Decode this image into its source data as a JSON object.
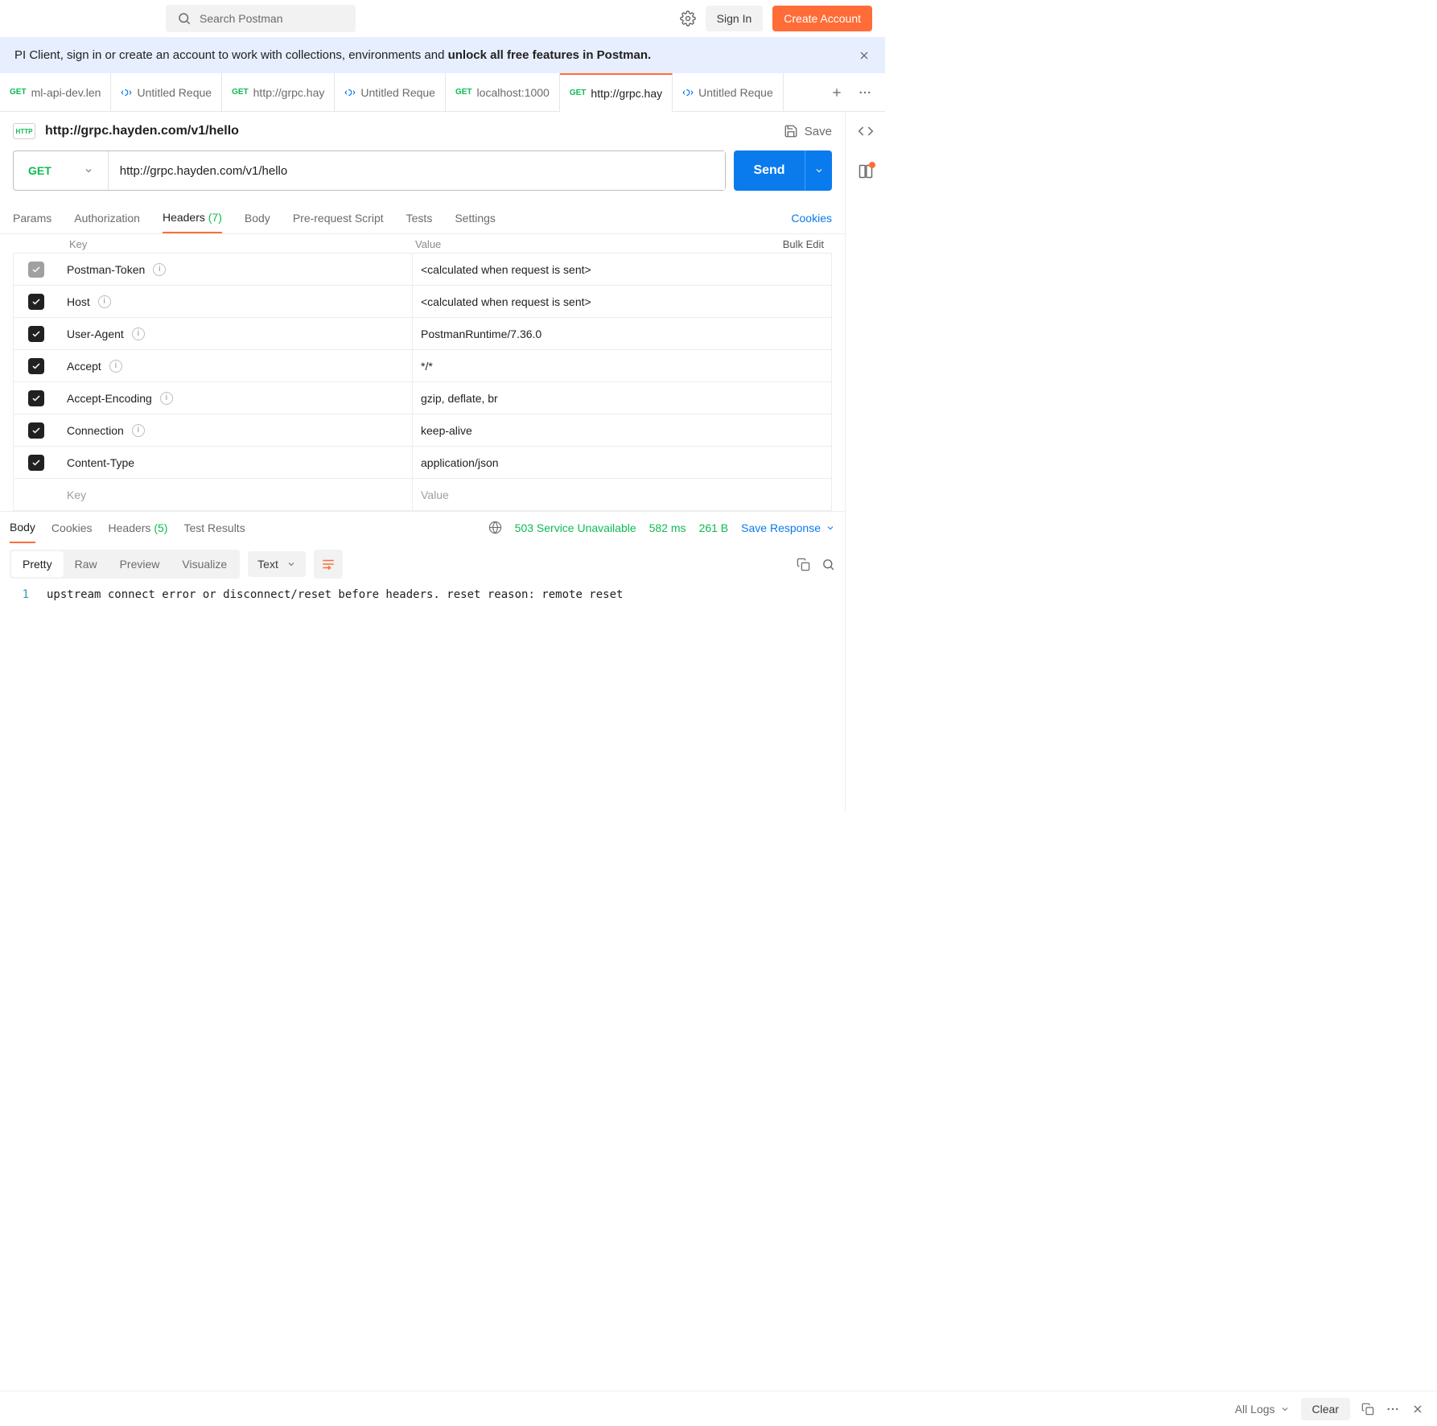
{
  "topbar": {
    "search_placeholder": "Search Postman",
    "signin": "Sign In",
    "create_account": "Create Account"
  },
  "banner": {
    "text_prefix": "PI Client, sign in or create an account to work with collections, environments and ",
    "text_bold": "unlock all free features in Postman."
  },
  "tabs": [
    {
      "method": "GET",
      "label": "ml-api-dev.len",
      "type": "http"
    },
    {
      "method": "",
      "label": "Untitled Reque",
      "type": "grpc"
    },
    {
      "method": "GET",
      "label": "http://grpc.hay",
      "type": "http"
    },
    {
      "method": "",
      "label": "Untitled Reque",
      "type": "grpc"
    },
    {
      "method": "GET",
      "label": "localhost:1000",
      "type": "http"
    },
    {
      "method": "GET",
      "label": "http://grpc.hay",
      "type": "http",
      "active": true
    },
    {
      "method": "",
      "label": "Untitled Reque",
      "type": "grpc"
    }
  ],
  "request": {
    "title": "http://grpc.hayden.com/v1/hello",
    "save": "Save",
    "method": "GET",
    "url": "http://grpc.hayden.com/v1/hello",
    "send": "Send"
  },
  "subtabs": {
    "params": "Params",
    "authorization": "Authorization",
    "headers": "Headers",
    "headers_count": "(7)",
    "body": "Body",
    "prerequest": "Pre-request Script",
    "tests": "Tests",
    "settings": "Settings",
    "cookies": "Cookies"
  },
  "headers_table": {
    "col_key": "Key",
    "col_value": "Value",
    "bulk_edit": "Bulk Edit",
    "key_placeholder": "Key",
    "value_placeholder": "Value",
    "rows": [
      {
        "enabled": false,
        "key": "Postman-Token",
        "value": "<calculated when request is sent>",
        "info": true
      },
      {
        "enabled": true,
        "key": "Host",
        "value": "<calculated when request is sent>",
        "info": true
      },
      {
        "enabled": true,
        "key": "User-Agent",
        "value": "PostmanRuntime/7.36.0",
        "info": true
      },
      {
        "enabled": true,
        "key": "Accept",
        "value": "*/*",
        "info": true
      },
      {
        "enabled": true,
        "key": "Accept-Encoding",
        "value": "gzip, deflate, br",
        "info": true
      },
      {
        "enabled": true,
        "key": "Connection",
        "value": "keep-alive",
        "info": true
      },
      {
        "enabled": true,
        "key": "Content-Type",
        "value": "application/json",
        "info": false
      }
    ]
  },
  "response_tabs": {
    "body": "Body",
    "cookies": "Cookies",
    "headers": "Headers",
    "headers_count": "(5)",
    "test_results": "Test Results"
  },
  "response_meta": {
    "status_code": "503",
    "status_text": "Service Unavailable",
    "time": "582 ms",
    "size": "261 B",
    "save_response": "Save Response"
  },
  "body_toolbar": {
    "pretty": "Pretty",
    "raw": "Raw",
    "preview": "Preview",
    "visualize": "Visualize",
    "format": "Text"
  },
  "response_body": {
    "line1": "upstream connect error or disconnect/reset before headers. reset reason: remote reset"
  },
  "footer": {
    "all_logs": "All Logs",
    "clear": "Clear"
  }
}
